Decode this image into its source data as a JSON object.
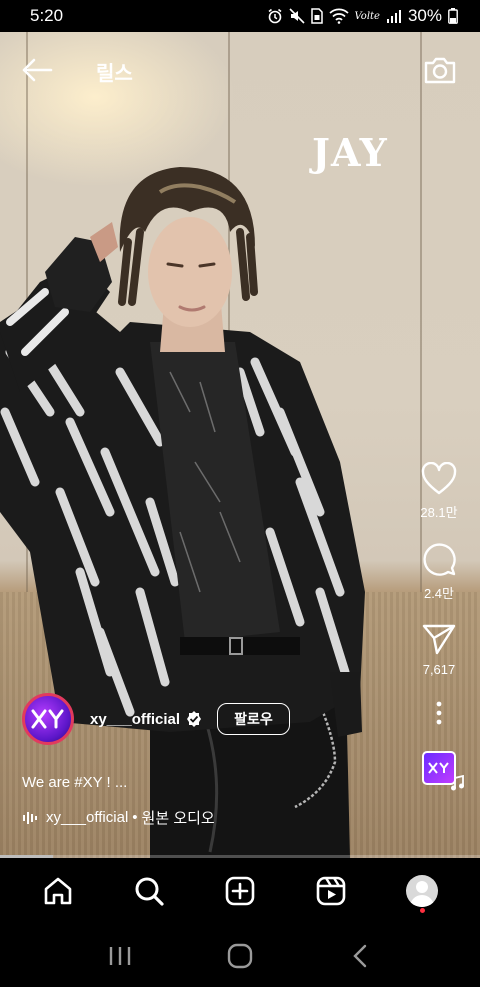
{
  "status_bar": {
    "time": "5:20",
    "network_label": "Volte",
    "battery": "30%"
  },
  "header": {
    "title": "릴스"
  },
  "video": {
    "overlay_text": "JAY"
  },
  "actions": {
    "likes": "28.1만",
    "comments": "2.4만",
    "shares": "7,617"
  },
  "author": {
    "username": "xy___official",
    "follow_label": "팔로우",
    "avatar_text": "XY"
  },
  "caption": "We are #XY ! ...",
  "audio": {
    "artist": "xy___official",
    "separator": "•",
    "title": "원본 오디오"
  },
  "playback": {
    "progress_fraction": 0.11
  },
  "icons": {
    "back": "arrow-left",
    "camera": "camera",
    "like": "heart",
    "comment": "speech-bubble",
    "share": "paper-plane",
    "more": "vertical-dots",
    "nav": [
      "home",
      "search",
      "create",
      "reels",
      "profile"
    ],
    "system": [
      "recents",
      "home",
      "back"
    ]
  },
  "colors": {
    "follow_border": "#ffffff",
    "avatar_ring": "#e23a5e",
    "notification_dot": "#ff3040"
  }
}
